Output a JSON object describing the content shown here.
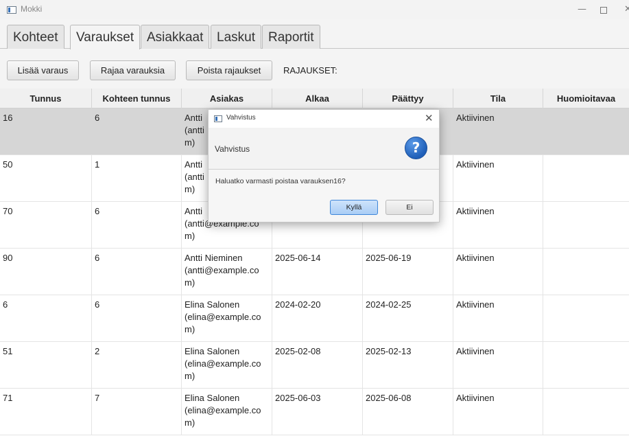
{
  "window": {
    "title": "Mokki",
    "minimize": "—",
    "close": "✕"
  },
  "tabs": [
    "Kohteet",
    "Varaukset",
    "Asiakkaat",
    "Laskut",
    "Raportit"
  ],
  "toolbar": {
    "add_label": "Lisää varaus",
    "filter_label": "Rajaa varauksia",
    "clear_label": "Poista rajaukset",
    "filters_caption": "RAJAUKSET:"
  },
  "table": {
    "columns": [
      "Tunnus",
      "Kohteen tunnus",
      "Asiakas",
      "Alkaa",
      "Päättyy",
      "Tila",
      "Huomioitavaa"
    ],
    "rows": [
      [
        "16",
        "6",
        "Antti\n(antti\nm)",
        "",
        "",
        "Aktiivinen",
        ""
      ],
      [
        "50",
        "1",
        "Antti\n(antti\nm)",
        "",
        "",
        "Aktiivinen",
        ""
      ],
      [
        "70",
        "6",
        "Antti\n(antti@example.co\nm)",
        "",
        "",
        "Aktiivinen",
        ""
      ],
      [
        "90",
        "6",
        "Antti Nieminen\n(antti@example.co\nm)",
        "2025-06-14",
        "2025-06-19",
        "Aktiivinen",
        ""
      ],
      [
        "6",
        "6",
        "Elina Salonen\n(elina@example.co\nm)",
        "2024-02-20",
        "2024-02-25",
        "Aktiivinen",
        ""
      ],
      [
        "51",
        "2",
        "Elina Salonen\n(elina@example.co\nm)",
        "2025-02-08",
        "2025-02-13",
        "Aktiivinen",
        ""
      ],
      [
        "71",
        "7",
        "Elina Salonen\n(elina@example.co\nm)",
        "2025-06-03",
        "2025-06-08",
        "Aktiivinen",
        ""
      ]
    ],
    "selected_row": 0
  },
  "dialog": {
    "title": "Vahvistus",
    "header": "Vahvistus",
    "message": "Haluatko varmasti poistaa varauksen16?",
    "icon": "question-icon",
    "icon_glyph": "?",
    "close_glyph": "✕",
    "yes_label": "Kyllä",
    "no_label": "Ei"
  }
}
